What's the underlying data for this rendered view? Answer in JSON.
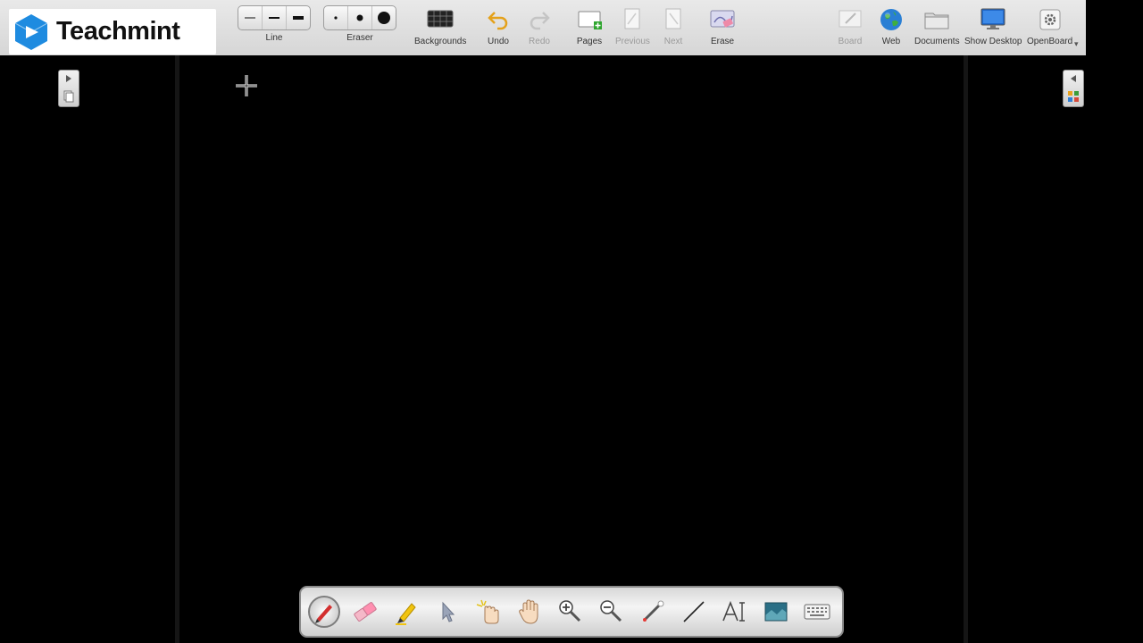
{
  "logo": {
    "text": "Teachmint",
    "icon": "teachmint-logo-icon"
  },
  "toolbar": {
    "line": {
      "label": "Line",
      "options": [
        "thin-line-icon",
        "medium-line-icon",
        "thick-line-icon"
      ]
    },
    "eraser": {
      "label": "Eraser",
      "options": [
        "small-eraser-icon",
        "medium-eraser-icon",
        "large-eraser-icon"
      ]
    },
    "backgrounds": {
      "label": "Backgrounds"
    },
    "undo": {
      "label": "Undo"
    },
    "redo": {
      "label": "Redo"
    },
    "pages": {
      "label": "Pages"
    },
    "previous": {
      "label": "Previous"
    },
    "next": {
      "label": "Next"
    },
    "erase": {
      "label": "Erase"
    },
    "board": {
      "label": "Board"
    },
    "web": {
      "label": "Web"
    },
    "documents": {
      "label": "Documents"
    },
    "show_desktop": {
      "label": "Show Desktop"
    },
    "openboard": {
      "label": "OpenBoard"
    }
  },
  "dock": {
    "tools": [
      "pen-icon",
      "eraser-icon",
      "marker-icon",
      "selector-icon",
      "interact-icon",
      "hand-icon",
      "zoom-in-icon",
      "zoom-out-icon",
      "laser-pointer-icon",
      "line-icon",
      "text-icon",
      "capture-icon",
      "keyboard-icon"
    ],
    "active_tool": "pen-icon"
  },
  "colors": {
    "toolbar_bg": "#dcdcdc",
    "board_bg": "#000000",
    "accent_red": "#d32f2f"
  }
}
